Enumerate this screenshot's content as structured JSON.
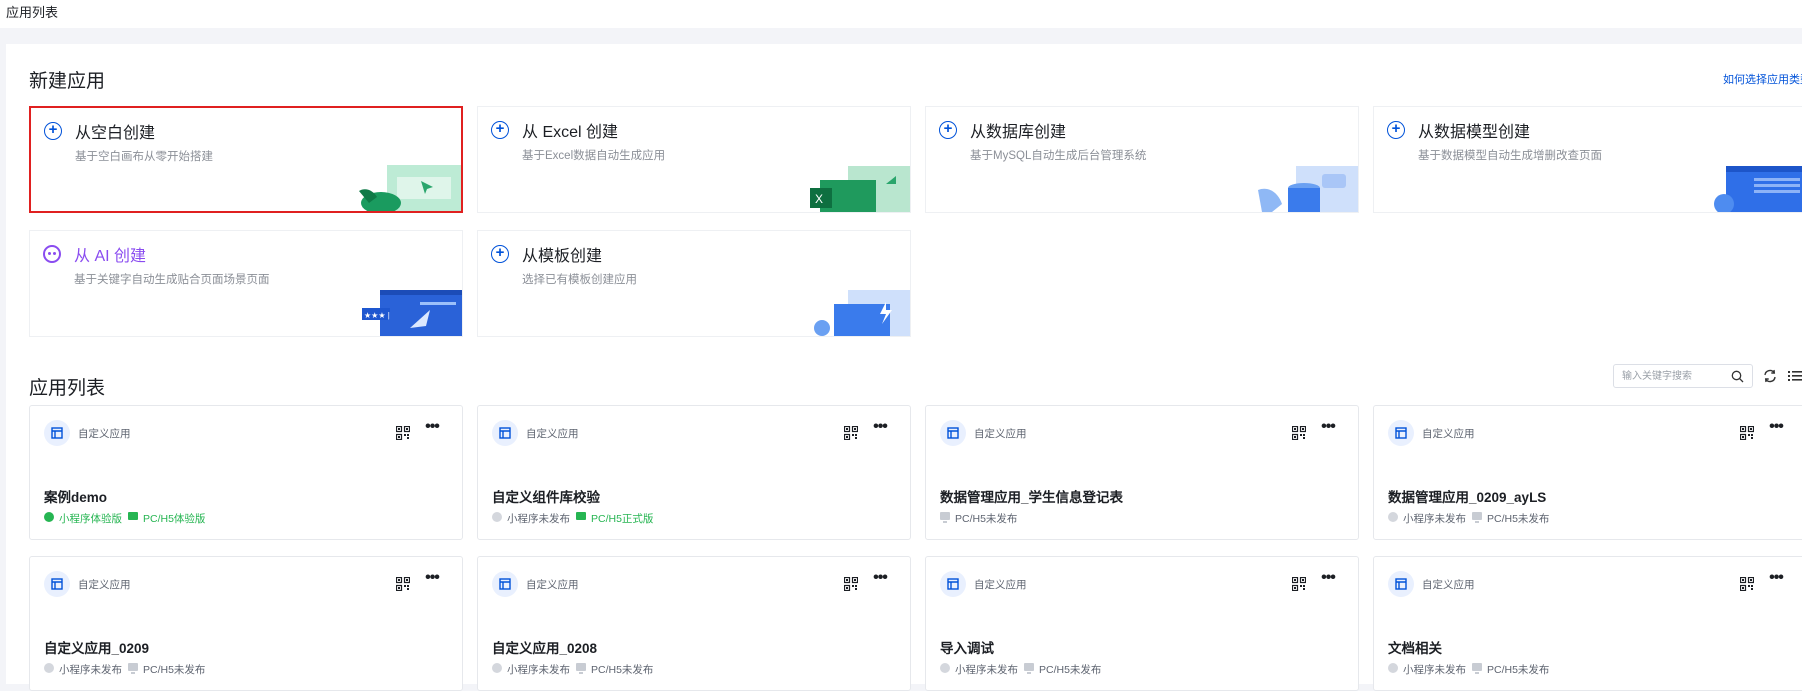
{
  "topbar": {
    "title": "应用列表"
  },
  "create": {
    "title": "新建应用",
    "help": "如何选择应用类型?",
    "cards": [
      {
        "title": "从空白创建",
        "sub": "基于空白画布从零开始搭建"
      },
      {
        "title": "从 Excel 创建",
        "sub": "基于Excel数据自动生成应用"
      },
      {
        "title": "从数据库创建",
        "sub": "基于MySQL自动生成后台管理系统"
      },
      {
        "title": "从数据模型创建",
        "sub": "基于数据模型自动生成增删改查页面"
      },
      {
        "title": "从 AI 创建",
        "sub": "基于关键字自动生成贴合页面场景页面"
      },
      {
        "title": "从模板创建",
        "sub": "选择已有模板创建应用"
      }
    ]
  },
  "list": {
    "title": "应用列表",
    "search_placeholder": "输入关键字搜索",
    "apps": [
      {
        "type": "自定义应用",
        "name": "案例demo",
        "mini": "小程序体验版",
        "pc": "PC/H5体验版"
      },
      {
        "type": "自定义应用",
        "name": "自定义组件库校验",
        "mini": "小程序未发布",
        "pc": "PC/H5正式版"
      },
      {
        "type": "自定义应用",
        "name": "数据管理应用_学生信息登记表",
        "pc": "PC/H5未发布"
      },
      {
        "type": "自定义应用",
        "name": "数据管理应用_0209_ayLS",
        "mini": "小程序未发布",
        "pc": "PC/H5未发布"
      },
      {
        "type": "自定义应用",
        "name": "自定义应用_0209",
        "mini": "小程序未发布",
        "pc": "PC/H5未发布"
      },
      {
        "type": "自定义应用",
        "name": "自定义应用_0208",
        "mini": "小程序未发布",
        "pc": "PC/H5未发布"
      },
      {
        "type": "自定义应用",
        "name": "导入调试",
        "mini": "小程序未发布",
        "pc": "PC/H5未发布"
      },
      {
        "type": "自定义应用",
        "name": "文档相关",
        "mini": "小程序未发布",
        "pc": "PC/H5未发布"
      }
    ]
  },
  "colors": {
    "accent": "#0052d9",
    "ai": "#8a4cf0",
    "success": "#26b552",
    "highlight": "#e02020"
  }
}
